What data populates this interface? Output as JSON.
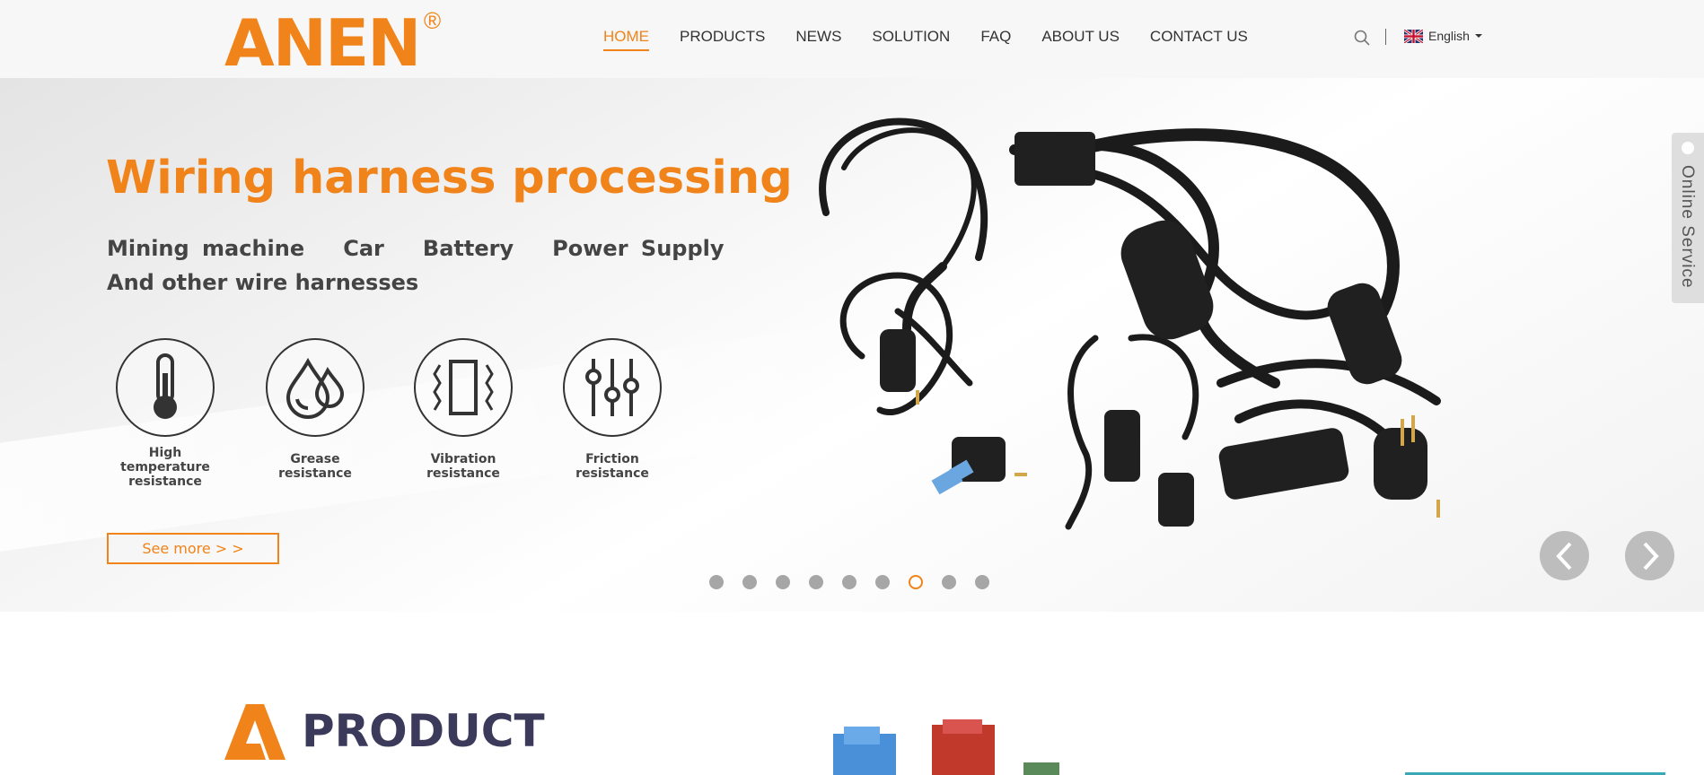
{
  "header": {
    "logo_text": "ANEN",
    "logo_mark": "®",
    "nav": [
      {
        "label": "HOME",
        "active": true
      },
      {
        "label": "PRODUCTS"
      },
      {
        "label": "NEWS"
      },
      {
        "label": "SOLUTION"
      },
      {
        "label": "FAQ"
      },
      {
        "label": "ABOUT US"
      },
      {
        "label": "CONTACT US"
      }
    ],
    "search_icon": "search-icon",
    "language": "English",
    "flag_icon": "uk-flag-icon"
  },
  "banner": {
    "title": "Wiring harness processing",
    "subtitle_line1": "Mining machine   Car   Battery   Power Supply",
    "subtitle_line2": "And other wire harnesses",
    "features": [
      {
        "icon": "thermometer-icon",
        "label": "High temperature resistance"
      },
      {
        "icon": "oil-drops-icon",
        "label": "Grease resistance"
      },
      {
        "icon": "vibration-icon",
        "label": "Vibration resistance"
      },
      {
        "icon": "sliders-icon",
        "label": "Friction resistance"
      }
    ],
    "button_label": "See more > >",
    "slide_count": 9,
    "active_slide": 7
  },
  "online_service": "Online Service",
  "product_section": {
    "title": "PRODUCT"
  },
  "colors": {
    "accent": "#f08319",
    "heading": "#3b3a5a"
  }
}
